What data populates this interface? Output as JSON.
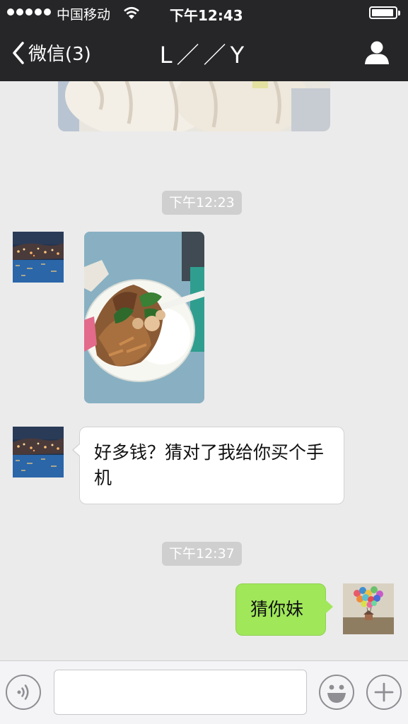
{
  "status_bar": {
    "carrier": "中国移动",
    "time": "下午12:43",
    "signal_bars": 5,
    "battery_level": 0.95
  },
  "nav": {
    "back_label": "微信(3)",
    "title": "L／／Y"
  },
  "chat": {
    "timestamps": [
      "下午12:23",
      "下午12:37"
    ],
    "messages": [
      {
        "from": "other",
        "type": "image"
      },
      {
        "from": "other",
        "type": "text",
        "text": "好多钱？猜对了我给你买个手机"
      },
      {
        "from": "me",
        "type": "text",
        "text": "猜你妹"
      }
    ]
  },
  "input": {
    "placeholder": "",
    "value": ""
  },
  "icons": {
    "back": "chevron-left-icon",
    "profile": "person-icon",
    "voice": "voice-icon",
    "emoji": "emoji-icon",
    "more": "plus-icon"
  }
}
